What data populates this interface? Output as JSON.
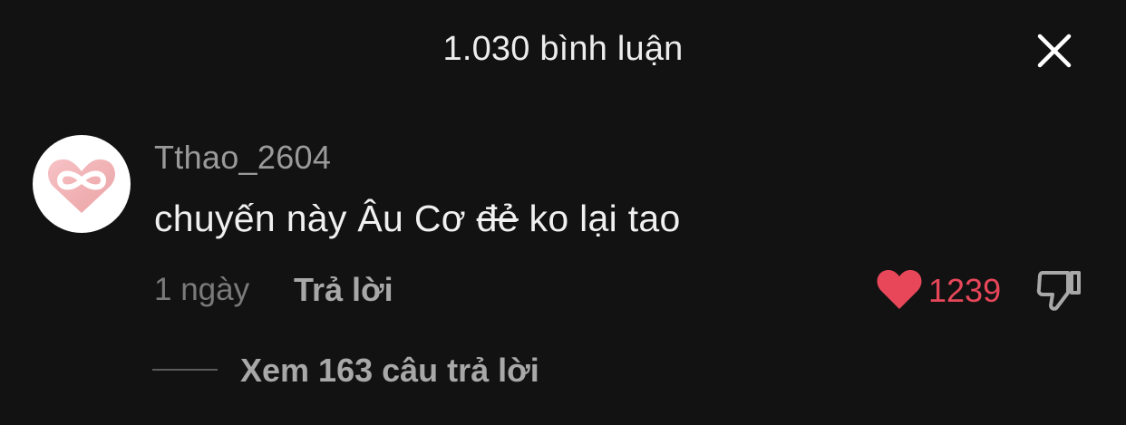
{
  "header": {
    "title": "1.030 bình luận",
    "close_icon": "close-icon"
  },
  "comment": {
    "avatar_icon": "infinity-heart-logo",
    "username": "Tthao_2604",
    "text_before": "chuyến này Âu Cơ ",
    "text_struck": "đẻ",
    "text_after": " ko lại tao",
    "time_ago": "1 ngày",
    "reply_label": "Trả lời",
    "like_icon": "heart-icon",
    "like_color": "#e8475a",
    "like_count": "1239",
    "dislike_icon": "thumbs-down-icon"
  },
  "replies": {
    "label": "Xem 163 câu trả lời"
  }
}
